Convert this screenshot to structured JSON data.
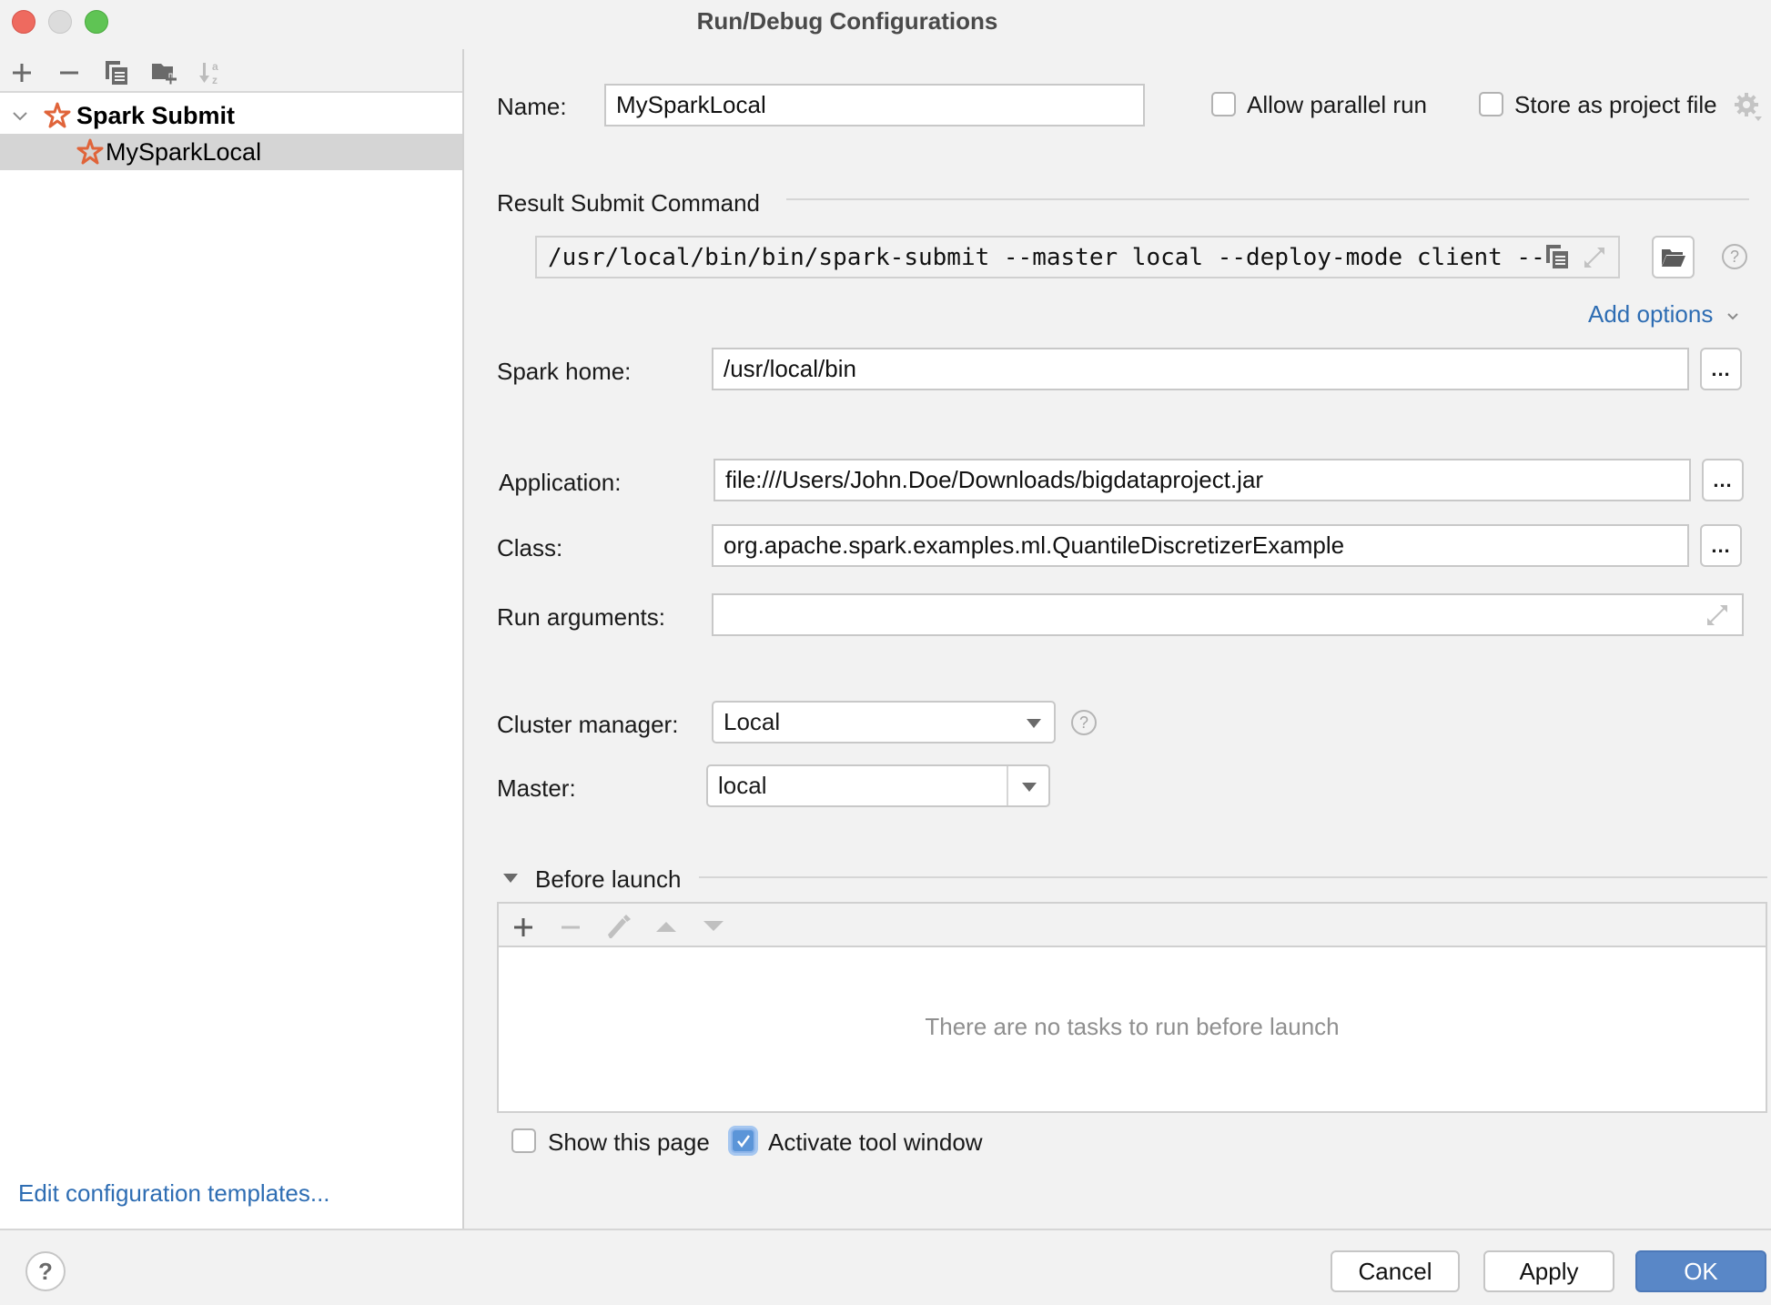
{
  "window": {
    "title": "Run/Debug Configurations"
  },
  "sidebar": {
    "toolbar": [
      {
        "name": "add-icon",
        "glyph": "+"
      },
      {
        "name": "remove-icon",
        "glyph": "−"
      },
      {
        "name": "copy-icon",
        "glyph": ""
      },
      {
        "name": "new-folder-icon",
        "glyph": ""
      },
      {
        "name": "sort-alpha-icon",
        "glyph": ""
      }
    ],
    "tree": [
      {
        "label": "Spark Submit",
        "type": "group",
        "expanded": true
      },
      {
        "label": "MySparkLocal",
        "type": "config",
        "selected": true
      }
    ],
    "edit_templates_link": "Edit configuration templates..."
  },
  "form": {
    "name_label": "Name:",
    "name_value": "MySparkLocal",
    "allow_parallel_label": "Allow parallel run",
    "allow_parallel_checked": false,
    "store_project_label": "Store as project file",
    "store_project_checked": false,
    "result_cmd_label": "Result Submit Command",
    "result_cmd_value": "/usr/local/bin/bin/spark-submit --master local --deploy-mode client --",
    "add_options_label": "Add options",
    "spark_home_label": "Spark home:",
    "spark_home_value": "/usr/local/bin",
    "application_label": "Application:",
    "application_value": "file:///Users/John.Doe/Downloads/bigdataproject.jar",
    "class_label": "Class:",
    "class_value": "org.apache.spark.examples.ml.QuantileDiscretizerExample",
    "run_args_label": "Run arguments:",
    "run_args_value": "",
    "cluster_manager_label": "Cluster manager:",
    "cluster_manager_value": "Local",
    "master_label": "Master:",
    "master_value": "local",
    "browse_label": "..."
  },
  "before_launch": {
    "title": "Before launch",
    "empty_text": "There are no tasks to run before launch",
    "show_page_label": "Show this page",
    "show_page_checked": false,
    "activate_tool_label": "Activate tool window",
    "activate_tool_checked": true
  },
  "footer": {
    "cancel": "Cancel",
    "apply": "Apply",
    "ok": "OK"
  },
  "colors": {
    "accent": "#5987c7",
    "link": "#2e6db3",
    "spark_icon": "#e0643a"
  }
}
